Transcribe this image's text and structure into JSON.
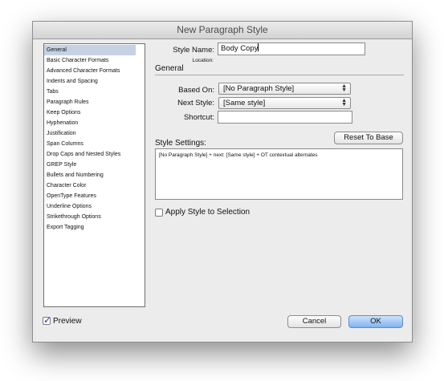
{
  "window": {
    "title": "New Paragraph Style"
  },
  "categories": [
    "General",
    "Basic Character Formats",
    "Advanced Character Formats",
    "Indents and Spacing",
    "Tabs",
    "Paragraph Rules",
    "Keep Options",
    "Hyphenation",
    "Justification",
    "Span Columns",
    "Drop Caps and Nested Styles",
    "GREP Style",
    "Bullets and Numbering",
    "Character Color",
    "OpenType Features",
    "Underline Options",
    "Strikethrough Options",
    "Export Tagging"
  ],
  "selected_category": "General",
  "style_name": {
    "label": "Style Name:",
    "value": "Body Copy"
  },
  "location": {
    "label": "Location:"
  },
  "general": {
    "heading": "General",
    "based_on": {
      "label": "Based On:",
      "value": "[No Paragraph Style]"
    },
    "next_style": {
      "label": "Next Style:",
      "value": "[Same style]"
    },
    "shortcut": {
      "label": "Shortcut:",
      "value": ""
    }
  },
  "style_settings": {
    "heading": "Style Settings:",
    "reset_label": "Reset To Base",
    "text": "[No Paragraph Style] + next: [Same style] + OT contextual alternates"
  },
  "apply_style": {
    "label": "Apply Style to Selection",
    "checked": false
  },
  "preview": {
    "label": "Preview",
    "checked": true
  },
  "buttons": {
    "cancel": "Cancel",
    "ok": "OK"
  }
}
